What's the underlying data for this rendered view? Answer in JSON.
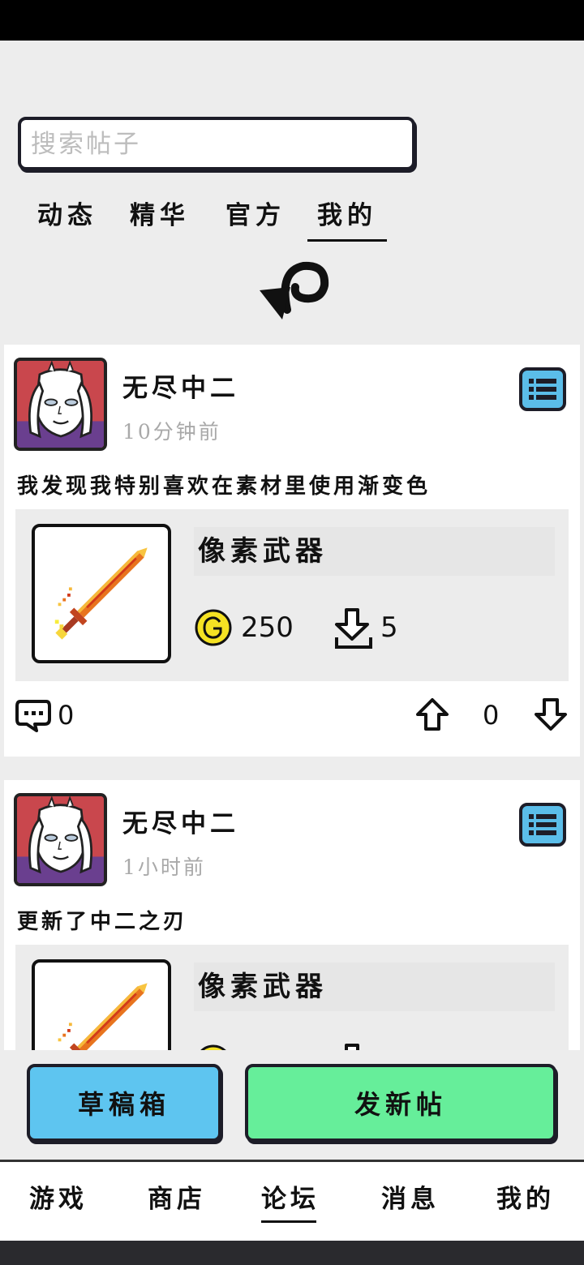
{
  "search": {
    "placeholder": "搜索帖子"
  },
  "tabs": [
    {
      "label": "动态"
    },
    {
      "label": "精华"
    },
    {
      "label": "官方"
    },
    {
      "label": "我的",
      "active": true
    }
  ],
  "posts": [
    {
      "username": "无尽中二",
      "time": "10分钟前",
      "text": "我发现我特别喜欢在素材里使用渐变色",
      "item": {
        "title": "像素武器",
        "price": "250",
        "downloads": "5"
      },
      "comments": "0",
      "votes": "0"
    },
    {
      "username": "无尽中二",
      "time": "1小时前",
      "text": "更新了中二之刃",
      "item": {
        "title": "像素武器"
      }
    }
  ],
  "actions": {
    "drafts": "草稿箱",
    "new_post": "发新帖"
  },
  "nav": [
    {
      "label": "游戏"
    },
    {
      "label": "商店"
    },
    {
      "label": "论坛",
      "active": true
    },
    {
      "label": "消息"
    },
    {
      "label": "我的"
    }
  ],
  "colors": {
    "drafts_button": "#5ec5f0",
    "new_post_button": "#66ee9a",
    "menu_button": "#5bbde9",
    "coin": "#f5e223"
  }
}
